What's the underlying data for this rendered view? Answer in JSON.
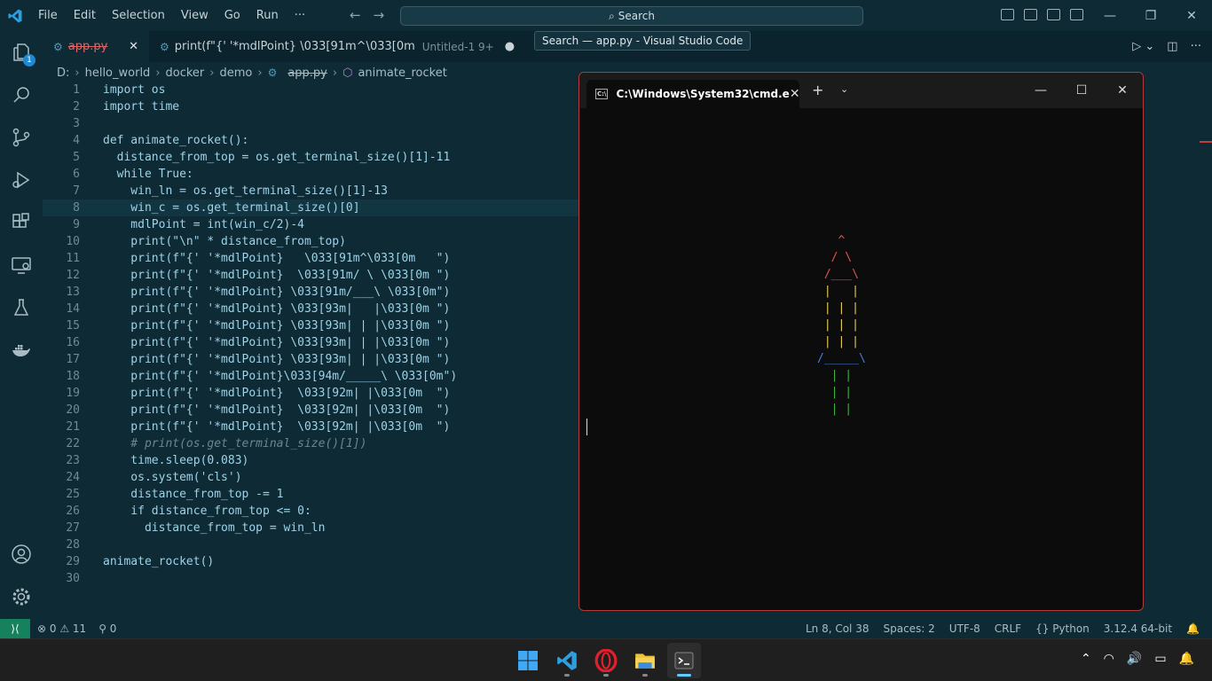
{
  "titlebar": {
    "menu": [
      "File",
      "Edit",
      "Selection",
      "View",
      "Go",
      "Run",
      "···"
    ],
    "search": "Search",
    "tooltip": "Search — app.py - Visual Studio Code"
  },
  "tabs": [
    {
      "label": "app.py",
      "active": true
    },
    {
      "label": "print(f\"{' '*mdlPoint} \\033[91m^\\033[0m",
      "sub": "Untitled-1 9+"
    }
  ],
  "breadcrumb": [
    "D:",
    "hello_world",
    "docker",
    "demo",
    "app.py",
    "animate_rocket"
  ],
  "code": [
    {
      "n": "1",
      "t": "import os"
    },
    {
      "n": "2",
      "t": "import time"
    },
    {
      "n": "3",
      "t": ""
    },
    {
      "n": "4",
      "t": "def animate_rocket():"
    },
    {
      "n": "5",
      "t": "  distance_from_top = os.get_terminal_size()[1]-11"
    },
    {
      "n": "6",
      "t": "  while True:"
    },
    {
      "n": "7",
      "t": "    win_ln = os.get_terminal_size()[1]-13"
    },
    {
      "n": "8",
      "t": "    win_c = os.get_terminal_size()[0]"
    },
    {
      "n": "9",
      "t": "    mdlPoint = int(win_c/2)-4"
    },
    {
      "n": "10",
      "t": "    print(\"\\n\" * distance_from_top)"
    },
    {
      "n": "11",
      "t": "    print(f\"{' '*mdlPoint}   \\033[91m^\\033[0m   \")"
    },
    {
      "n": "12",
      "t": "    print(f\"{' '*mdlPoint}  \\033[91m/ \\ \\033[0m \")"
    },
    {
      "n": "13",
      "t": "    print(f\"{' '*mdlPoint} \\033[91m/___\\ \\033[0m\")"
    },
    {
      "n": "14",
      "t": "    print(f\"{' '*mdlPoint} \\033[93m|   |\\033[0m \")"
    },
    {
      "n": "15",
      "t": "    print(f\"{' '*mdlPoint} \\033[93m| | |\\033[0m \")"
    },
    {
      "n": "16",
      "t": "    print(f\"{' '*mdlPoint} \\033[93m| | |\\033[0m \")"
    },
    {
      "n": "17",
      "t": "    print(f\"{' '*mdlPoint} \\033[93m| | |\\033[0m \")"
    },
    {
      "n": "18",
      "t": "    print(f\"{' '*mdlPoint}\\033[94m/_____\\ \\033[0m\")"
    },
    {
      "n": "19",
      "t": "    print(f\"{' '*mdlPoint}  \\033[92m| |\\033[0m  \")"
    },
    {
      "n": "20",
      "t": "    print(f\"{' '*mdlPoint}  \\033[92m| |\\033[0m  \")"
    },
    {
      "n": "21",
      "t": "    print(f\"{' '*mdlPoint}  \\033[92m| |\\033[0m  \")"
    },
    {
      "n": "22",
      "t": "    # print(os.get_terminal_size()[1])"
    },
    {
      "n": "23",
      "t": "    time.sleep(0.083)"
    },
    {
      "n": "24",
      "t": "    os.system('cls')"
    },
    {
      "n": "25",
      "t": "    distance_from_top -= 1"
    },
    {
      "n": "26",
      "t": "    if distance_from_top <= 0:"
    },
    {
      "n": "27",
      "t": "      distance_from_top = win_ln"
    },
    {
      "n": "28",
      "t": ""
    },
    {
      "n": "29",
      "t": "animate_rocket()"
    },
    {
      "n": "30",
      "t": ""
    }
  ],
  "terminal": {
    "tab_title": "C:\\Windows\\System32\\cmd.e",
    "rocket": [
      {
        "t": "   ^   ",
        "c": "rr"
      },
      {
        "t": "  / \\  ",
        "c": "rr"
      },
      {
        "t": " /___\\ ",
        "c": "rr"
      },
      {
        "t": " |   | ",
        "c": "ry"
      },
      {
        "t": " | | | ",
        "c": "ry"
      },
      {
        "t": " | | | ",
        "c": "ry"
      },
      {
        "t": " | | | ",
        "c": "ry"
      },
      {
        "t": "/_____\\",
        "c": "rb"
      },
      {
        "t": "  | |  ",
        "c": "rg"
      },
      {
        "t": "  | |  ",
        "c": "rg"
      },
      {
        "t": "  | |  ",
        "c": "rg"
      }
    ]
  },
  "status": {
    "errors": "0",
    "warnings": "11",
    "ports": "0",
    "position": "Ln 8, Col 38",
    "spaces": "Spaces: 2",
    "encoding": "UTF-8",
    "eol": "CRLF",
    "language": "Python",
    "interpreter": "3.12.4 64-bit"
  }
}
